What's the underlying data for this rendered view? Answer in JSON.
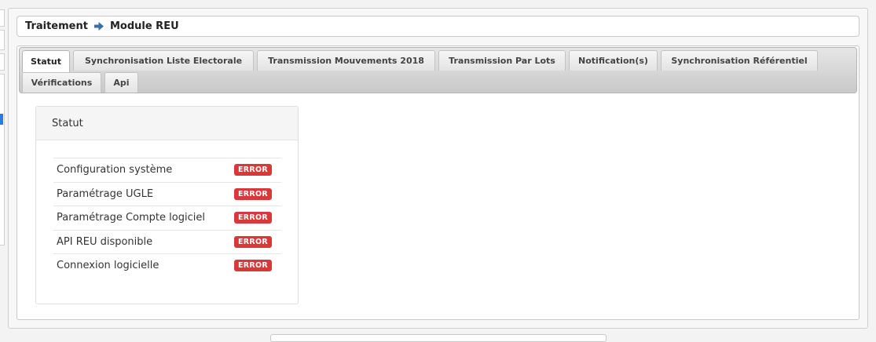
{
  "breadcrumb": {
    "parent": "Traitement",
    "current": "Module REU"
  },
  "tabs": [
    {
      "label": "Statut",
      "active": true
    },
    {
      "label": "Synchronisation Liste Electorale",
      "active": false
    },
    {
      "label": "Transmission Mouvements 2018",
      "active": false
    },
    {
      "label": "Transmission Par Lots",
      "active": false
    },
    {
      "label": "Notification(s)",
      "active": false
    },
    {
      "label": "Synchronisation Référentiel",
      "active": false
    },
    {
      "label": "Vérifications",
      "active": false
    },
    {
      "label": "Api",
      "active": false
    }
  ],
  "status_card": {
    "title": "Statut",
    "rows": [
      {
        "label": "Configuration système",
        "status": "ERROR"
      },
      {
        "label": "Paramétrage UGLE",
        "status": "ERROR"
      },
      {
        "label": "Paramétrage Compte logiciel",
        "status": "ERROR"
      },
      {
        "label": "API REU disponible",
        "status": "ERROR"
      },
      {
        "label": "Connexion logicielle",
        "status": "ERROR"
      }
    ]
  },
  "colors": {
    "error_badge": "#d9383a",
    "breadcrumb_arrow": "#3a6ea5",
    "accent": "#2a7ae2"
  }
}
